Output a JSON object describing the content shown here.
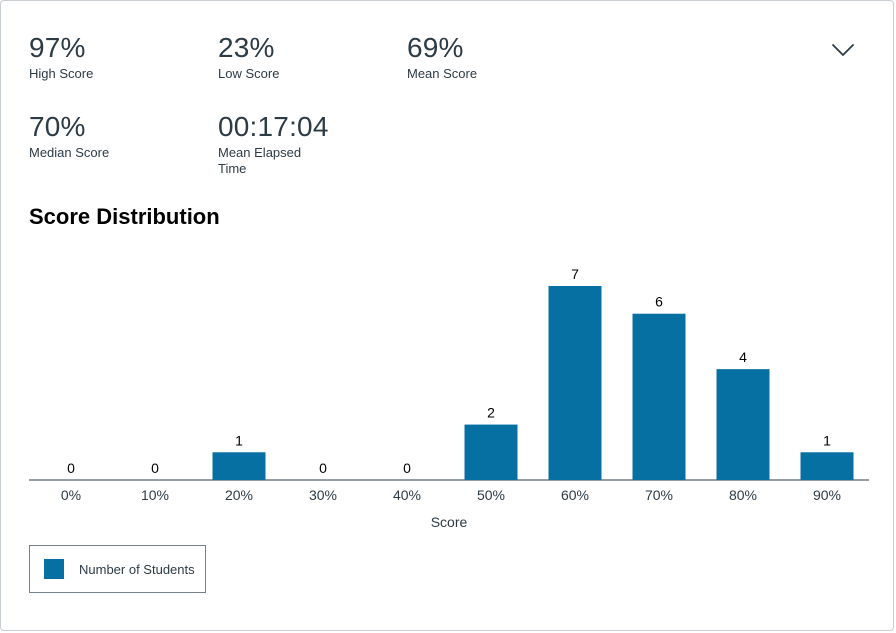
{
  "stats": {
    "high": {
      "value": "97%",
      "label": "High Score"
    },
    "low": {
      "value": "23%",
      "label": "Low Score"
    },
    "mean": {
      "value": "69%",
      "label": "Mean Score"
    },
    "median": {
      "value": "70%",
      "label": "Median Score"
    },
    "elapsed": {
      "value": "00:17:04",
      "label": "Mean Elapsed Time"
    }
  },
  "toggle_icon": "chevron-down-icon",
  "section_title": "Score Distribution",
  "colors": {
    "bar": "#0770a3",
    "text": "#2d3b45",
    "axis": "#2d3b45"
  },
  "chart_data": {
    "type": "bar",
    "title": "Score Distribution",
    "xlabel": "Score",
    "ylabel": "",
    "categories": [
      "0%",
      "10%",
      "20%",
      "30%",
      "40%",
      "50%",
      "60%",
      "70%",
      "80%",
      "90%"
    ],
    "series": [
      {
        "name": "Number of Students",
        "values": [
          0,
          0,
          1,
          0,
          0,
          2,
          7,
          6,
          4,
          1
        ]
      }
    ],
    "ylim": [
      0,
      7
    ],
    "grid": false,
    "data_labels": true,
    "legend": "bottom-left"
  },
  "legend": {
    "label": "Number of Students"
  }
}
